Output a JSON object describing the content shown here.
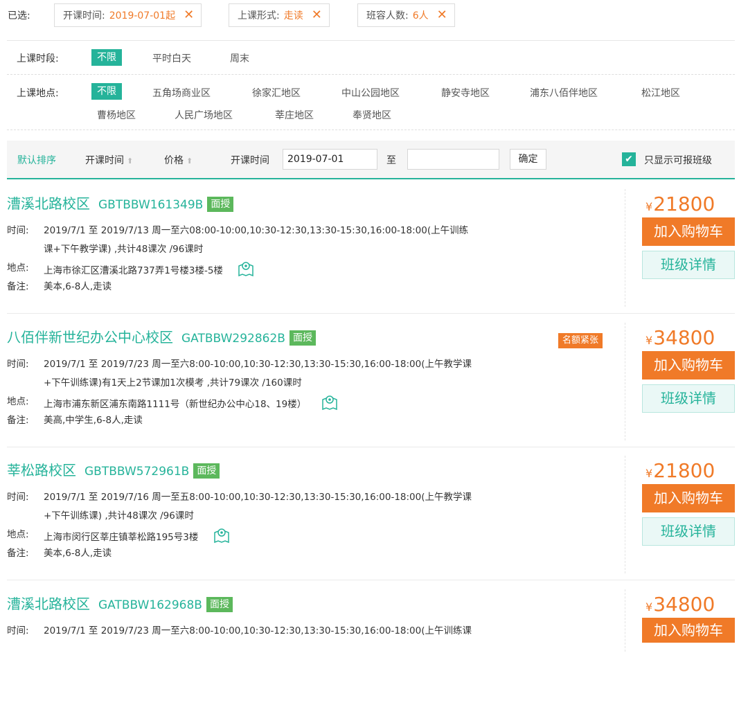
{
  "selected": {
    "label": "已选:",
    "chips": [
      {
        "key": "开课时间:",
        "value": "2019-07-01起"
      },
      {
        "key": "上课形式:",
        "value": "走读"
      },
      {
        "key": "班容人数:",
        "value": "6人"
      }
    ],
    "remove_glyph": "✕"
  },
  "filters": {
    "period": {
      "label": "上课时段:",
      "options": [
        "不限",
        "平时白天",
        "周末"
      ],
      "active": "不限"
    },
    "location": {
      "label": "上课地点:",
      "options_row1": [
        "不限",
        "五角场商业区",
        "徐家汇地区",
        "中山公园地区",
        "静安寺地区",
        "浦东八佰伴地区",
        "松江地区"
      ],
      "options_row2": [
        "曹杨地区",
        "人民广场地区",
        "莘庄地区",
        "奉贤地区"
      ],
      "active": "不限"
    }
  },
  "sort": {
    "default": "默认排序",
    "start_time": "开课时间",
    "price": "价格",
    "range_label": "开课时间",
    "from_value": "2019-07-01",
    "to_word": "至",
    "to_value": "",
    "confirm": "确定",
    "only_available": "只显示可报班级",
    "only_available_checked": true
  },
  "labels": {
    "time": "时间:",
    "place": "地点:",
    "note": "备注:",
    "add_to_cart": "加入购物车",
    "class_detail": "班级详情",
    "currency": "¥"
  },
  "courses": [
    {
      "campus": "漕溪北路校区",
      "code": "GBTBBW161349B",
      "mode": "面授",
      "tag": "",
      "time_line1": "2019/7/1 至 2019/7/13 周一至六08:00-10:00,10:30-12:30,13:30-15:30,16:00-18:00(上午训练",
      "time_line2": "课+下午教学课) ,共计48课次 /96课时",
      "place": "上海市徐汇区漕溪北路737弄1号楼3楼-5楼",
      "note": "美本,6-8人,走读",
      "price": "21800"
    },
    {
      "campus": "八佰伴新世纪办公中心校区",
      "code": "GATBBW292862B",
      "mode": "面授",
      "tag": "名额紧张",
      "time_line1": "2019/7/1 至 2019/7/23 周一至六8:00-10:00,10:30-12:30,13:30-15:30,16:00-18:00(上午教学课",
      "time_line2": "+下午训练课)有1天上2节课加1次模考 ,共计79课次 /160课时",
      "place": "上海市浦东新区浦东南路1111号（新世纪办公中心18、19楼）",
      "note": "美高,中学生,6-8人,走读",
      "price": "34800"
    },
    {
      "campus": "莘松路校区",
      "code": "GBTBBW572961B",
      "mode": "面授",
      "tag": "",
      "time_line1": "2019/7/1 至 2019/7/16 周一至五8:00-10:00,10:30-12:30,13:30-15:30,16:00-18:00(上午教学课",
      "time_line2": "+下午训练课) ,共计48课次 /96课时",
      "place": "上海市闵行区莘庄镇莘松路195号3楼",
      "note": "美本,6-8人,走读",
      "price": "21800"
    },
    {
      "campus": "漕溪北路校区",
      "code": "GATBBW162968B",
      "mode": "面授",
      "tag": "",
      "time_line1": "2019/7/1 至 2019/7/23 周一至六8:00-10:00,10:30-12:30,13:30-15:30,16:00-18:00(上午训练课",
      "time_line2": "",
      "place": "",
      "note": "",
      "price": "34800"
    }
  ],
  "colors": {
    "accent": "#25b39a",
    "orange": "#f07a28",
    "badge_green": "#5cb85c"
  },
  "icons": {
    "remove": "close-icon",
    "sort_arrow": "arrow-up-icon",
    "map": "map-pin-icon",
    "check": "checkmark-icon"
  }
}
